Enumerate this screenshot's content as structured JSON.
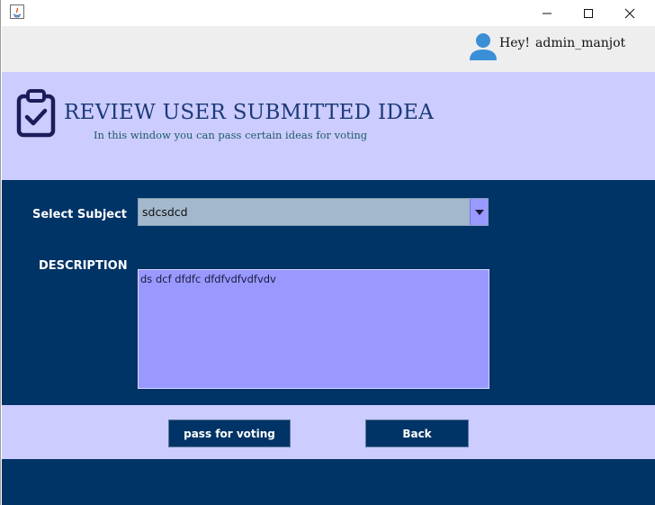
{
  "titlebar": {
    "app_icon": "java-icon",
    "controls": [
      "minimize-icon",
      "maximize-icon",
      "close-icon"
    ]
  },
  "header": {
    "greeting": "Hey!",
    "username": "admin_manjot",
    "user_icon": "user-icon"
  },
  "title_panel": {
    "icon": "clipboard-check-icon",
    "title": "REVIEW USER SUBMITTED IDEA",
    "subtitle": "In this window you can pass certain ideas for voting"
  },
  "form": {
    "subject_label": "Select Subject",
    "subject_value": "sdcsdcd",
    "description_label": "DESCRIPTION",
    "description_value": "ds dcf dfdfc dfdfvdfvdfvdv"
  },
  "actions": {
    "pass_label": "pass for voting",
    "back_label": "Back"
  },
  "colors": {
    "dark_navy": "#003366",
    "lavender": "#ccccff",
    "periwinkle": "#9999ff",
    "select_bg": "#a3b8cc",
    "title_blue": "#1c3a78"
  }
}
